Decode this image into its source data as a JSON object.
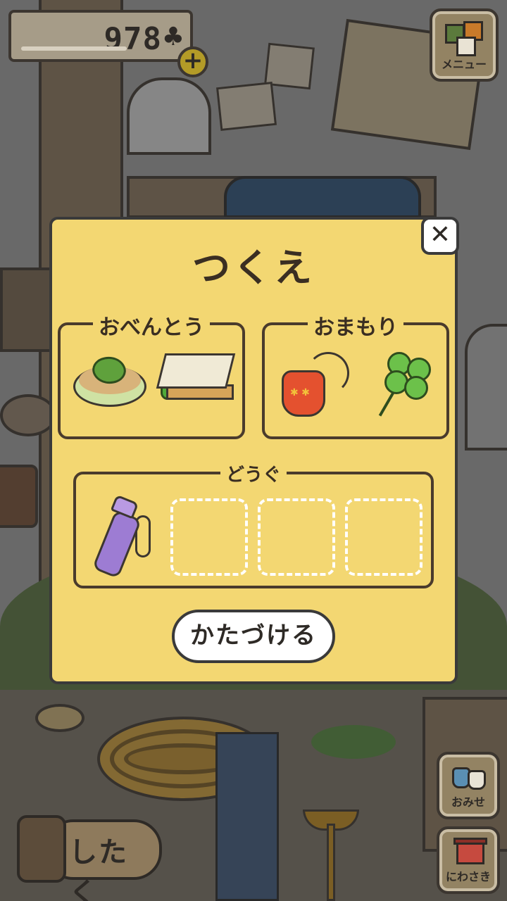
{
  "hud": {
    "clover_count": "978",
    "clover_symbol": "♣",
    "add_symbol": "+",
    "menu_label": "メニュー",
    "shop_label": "おみせ",
    "garden_label": "にわさき",
    "prepare_label": "したく"
  },
  "dialog": {
    "title": "つくえ",
    "close_symbol": "✕",
    "sections": {
      "bento": {
        "label": "おべんとう",
        "items": [
          "cracker-icon",
          "sandwich-icon"
        ]
      },
      "charm": {
        "label": "おまもり",
        "items": [
          "charm-pouch-icon",
          "four-leaf-clover-icon"
        ]
      },
      "tool": {
        "label": "どうぐ",
        "items": [
          "water-bottle-icon"
        ],
        "empty_slots": 3
      }
    },
    "putaway_label": "かたづける"
  },
  "colors": {
    "dialog_bg": "#f3d772",
    "button_bg": "#ffffff",
    "text_dark": "#2e2a26"
  }
}
